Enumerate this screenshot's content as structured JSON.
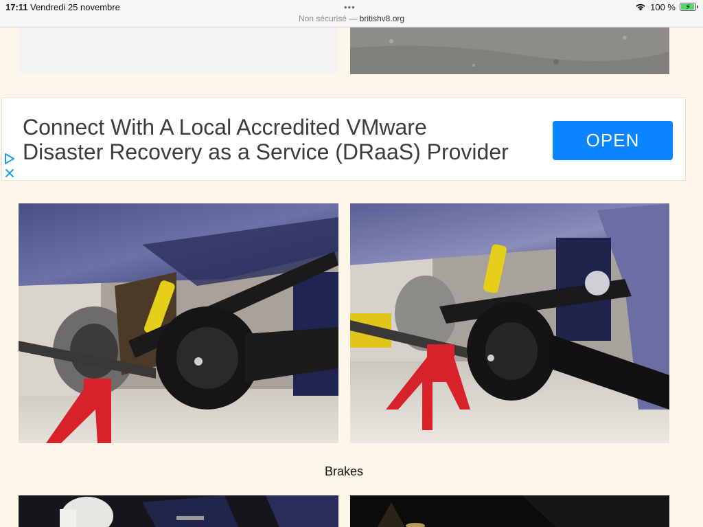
{
  "status_bar": {
    "time": "17:11",
    "date": "Vendredi 25 novembre",
    "url_prefix": "Non sécurisé —",
    "url_domain": "britishv8.org",
    "battery": "100 %",
    "battery_level": 1.0
  },
  "ad": {
    "line1": "Connect With A Local Accredited VMware",
    "line2": "Disaster Recovery as a Service (DRaaS) Provider",
    "button_label": "OPEN",
    "accent": "#0a84ff"
  },
  "gallery": {
    "caption": "Brakes"
  }
}
